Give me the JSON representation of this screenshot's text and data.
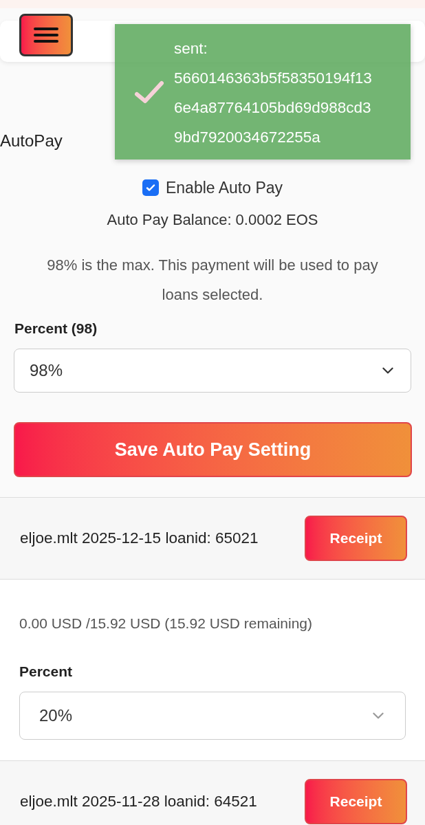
{
  "toast": {
    "message": "sent: 5660146363b5f58350194f136e4a87764105bd69d988cd39bd7920034672255a"
  },
  "autopay": {
    "heading": "AutoPay",
    "enable": {
      "label": "Enable Auto Pay",
      "checked": true
    },
    "balance": "Auto Pay Balance: 0.0002 EOS",
    "note": "98% is the max. This payment will be used to pay loans selected.",
    "percent_label": "Percent (98)",
    "percent_value": "98%",
    "save_button": "Save Auto Pay Setting"
  },
  "loans": [
    {
      "title": "eljoe.mlt 2025-12-15 loanid: 65021",
      "button": "Receipt",
      "amount": "0.00 USD /15.92 USD (15.92 USD remaining)",
      "percent_label": "Percent",
      "percent_value": "20%"
    },
    {
      "title": "eljoe.mlt 2025-11-28 loanid: 64521",
      "button": "Receipt"
    }
  ]
}
